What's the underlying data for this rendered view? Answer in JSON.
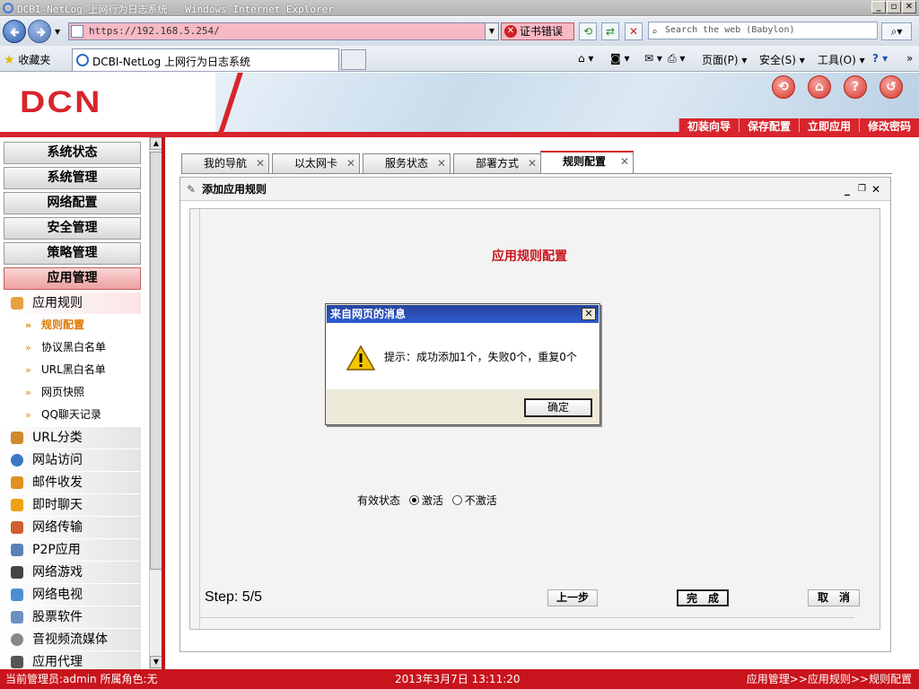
{
  "window": {
    "title": "DCBI-NetLog 上网行为日志系统 - Windows Internet Explorer",
    "min": "_",
    "max": "▫",
    "close": "✕"
  },
  "browser": {
    "url": "https://192.168.5.254/",
    "cert_error": "证书错误",
    "search_placeholder": "Search the web (Babylon)",
    "favorites": "收藏夹",
    "tab_title": "DCBI-NetLog 上网行为日志系统",
    "cmd_page": "页面(P)",
    "cmd_safety": "安全(S)",
    "cmd_tools": "工具(O)"
  },
  "header": {
    "logo": "DCN",
    "links": [
      "初装向导",
      "保存配置",
      "立即应用",
      "修改密码"
    ]
  },
  "sidebar": {
    "groups": [
      "系统状态",
      "系统管理",
      "网络配置",
      "安全管理",
      "策略管理",
      "应用管理"
    ],
    "app_rule": "应用规则",
    "app_rule_items": [
      "规则配置",
      "协议黑白名单",
      "URL黑白名单",
      "网页快照",
      "QQ聊天记录"
    ],
    "items": [
      "URL分类",
      "网站访问",
      "邮件收发",
      "即时聊天",
      "网络传输",
      "P2P应用",
      "网络游戏",
      "网络电视",
      "股票软件",
      "音视频流媒体",
      "应用代理"
    ]
  },
  "tabs": [
    "我的导航",
    "以太网卡",
    "服务状态",
    "部署方式",
    "规则配置"
  ],
  "panel": {
    "title": "添加应用规则",
    "heading": "应用规则配置",
    "status_label": "有效状态",
    "opt_active": "激活",
    "opt_inactive": "不激活",
    "step": "Step: 5/5",
    "prev": "上一步",
    "finish": "完　成",
    "cancel": "取　消"
  },
  "dialog": {
    "title": "来自网页的消息",
    "message": "提示：成功添加1个，失败0个，重复0个",
    "ok": "确定"
  },
  "footer": {
    "admin": "当前管理员:admin  所属角色:无",
    "datetime": "2013年3月7日 13:11:20",
    "breadcrumb": "应用管理>>应用规则>>规则配置"
  },
  "colors": {
    "brand_red": "#d8242c"
  }
}
